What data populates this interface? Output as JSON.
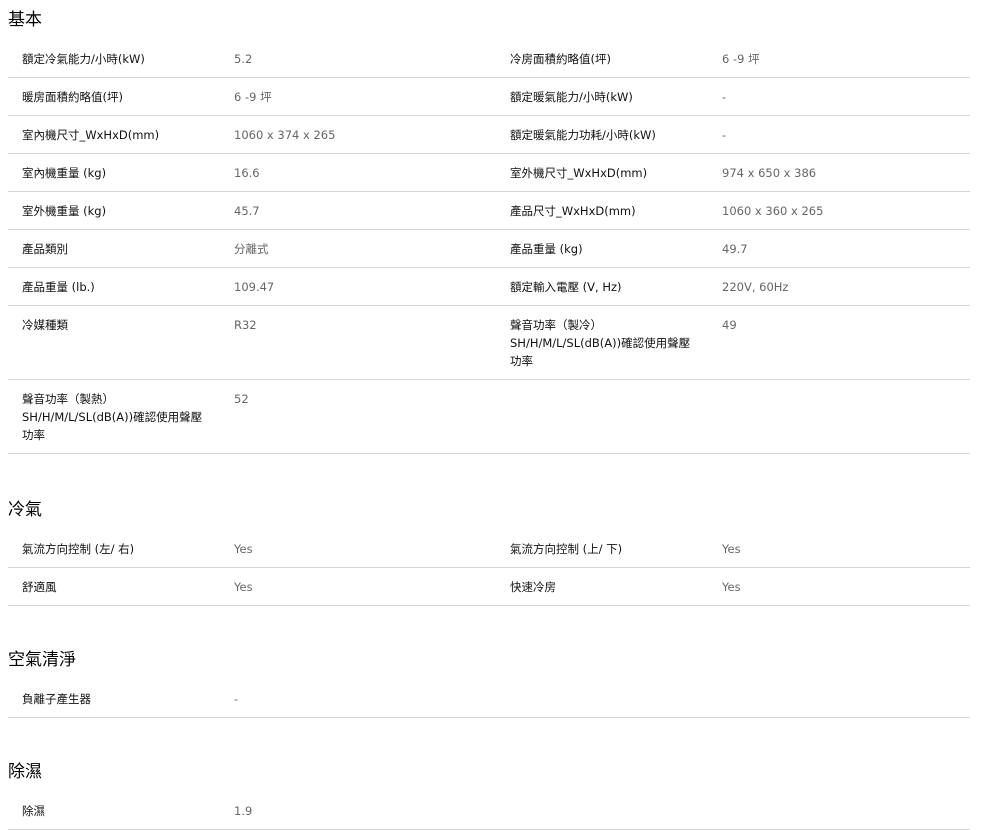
{
  "sections": [
    {
      "title": "基本",
      "rows": [
        [
          {
            "k": "額定冷氣能力/小時(kW)",
            "v": "5.2"
          },
          {
            "k": "冷房面積約略值(坪)",
            "v": "6 -9 坪"
          }
        ],
        [
          {
            "k": "暖房面積約略值(坪)",
            "v": "6 -9 坪"
          },
          {
            "k": "額定暖氣能力/小時(kW)",
            "v": "-"
          }
        ],
        [
          {
            "k": "室內機尺寸_WxHxD(mm)",
            "v": "1060 x 374 x 265"
          },
          {
            "k": "額定暖氣能力功耗/小時(kW)",
            "v": "-"
          }
        ],
        [
          {
            "k": "室內機重量 (kg)",
            "v": "16.6"
          },
          {
            "k": "室外機尺寸_WxHxD(mm)",
            "v": "974 x 650 x 386"
          }
        ],
        [
          {
            "k": "室外機重量 (kg)",
            "v": "45.7"
          },
          {
            "k": "產品尺寸_WxHxD(mm)",
            "v": "1060 x 360 x 265"
          }
        ],
        [
          {
            "k": "產品類別",
            "v": "分離式"
          },
          {
            "k": "產品重量 (kg)",
            "v": "49.7"
          }
        ],
        [
          {
            "k": "產品重量 (lb.)",
            "v": "109.47"
          },
          {
            "k": "額定輸入電壓 (V, Hz)",
            "v": "220V, 60Hz"
          }
        ],
        [
          {
            "k": "冷媒種類",
            "v": "R32"
          },
          {
            "k": "聲音功率（製冷）SH/H/M/L/SL(dB(A))確認使用聲壓功率",
            "v": "49"
          }
        ],
        [
          {
            "k": "聲音功率（製熱）SH/H/M/L/SL(dB(A))確認使用聲壓功率",
            "v": "52"
          },
          {
            "k": "",
            "v": ""
          }
        ]
      ]
    },
    {
      "title": "冷氣",
      "rows": [
        [
          {
            "k": "氣流方向控制 (左/ 右)",
            "v": "Yes"
          },
          {
            "k": "氣流方向控制 (上/ 下)",
            "v": "Yes"
          }
        ],
        [
          {
            "k": "舒適風",
            "v": "Yes"
          },
          {
            "k": "快速冷房",
            "v": "Yes"
          }
        ]
      ]
    },
    {
      "title": "空氣清淨",
      "rows": [
        [
          {
            "k": "負離子產生器",
            "v": "-"
          },
          {
            "k": "",
            "v": ""
          }
        ]
      ]
    },
    {
      "title": "除濕",
      "rows": [
        [
          {
            "k": "除濕",
            "v": "1.9"
          },
          {
            "k": "",
            "v": ""
          }
        ]
      ]
    }
  ]
}
